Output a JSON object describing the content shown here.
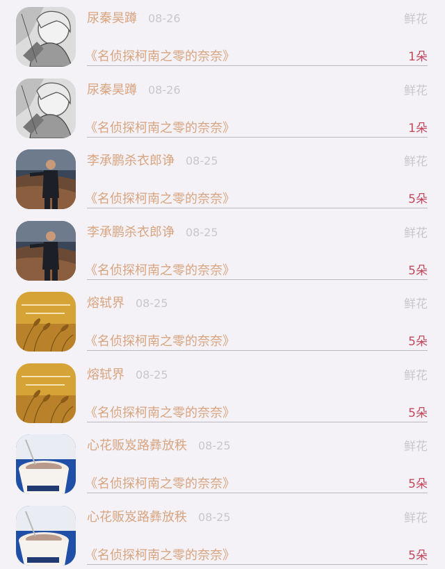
{
  "items": [
    {
      "name": "尿秦昊蹲",
      "date": "08-26",
      "gift_type": "鲜花",
      "book": "《名侦探柯南之零的奈奈》",
      "count": "1朵",
      "avatar_icon": "anime-sketch-avatar-icon"
    },
    {
      "name": "尿秦昊蹲",
      "date": "08-26",
      "gift_type": "鲜花",
      "book": "《名侦探柯南之零的奈奈》",
      "count": "1朵",
      "avatar_icon": "anime-sketch-avatar-icon"
    },
    {
      "name": "李承鹏杀衣郎诤",
      "date": "08-25",
      "gift_type": "鲜花",
      "book": "《名侦探柯南之零的奈奈》",
      "count": "5朵",
      "avatar_icon": "suited-man-avatar-icon"
    },
    {
      "name": "李承鹏杀衣郎诤",
      "date": "08-25",
      "gift_type": "鲜花",
      "book": "《名侦探柯南之零的奈奈》",
      "count": "5朵",
      "avatar_icon": "suited-man-avatar-icon"
    },
    {
      "name": "熔轼界",
      "date": "08-25",
      "gift_type": "鲜花",
      "book": "《名侦探柯南之零的奈奈》",
      "count": "5朵",
      "avatar_icon": "wheat-field-avatar-icon"
    },
    {
      "name": "熔轼界",
      "date": "08-25",
      "gift_type": "鲜花",
      "book": "《名侦探柯南之零的奈奈》",
      "count": "5朵",
      "avatar_icon": "wheat-field-avatar-icon"
    },
    {
      "name": "心花贩岌路彝放秩",
      "date": "08-25",
      "gift_type": "鲜花",
      "book": "《名侦探柯南之零的奈奈》",
      "count": "5朵",
      "avatar_icon": "coffee-cup-avatar-icon"
    },
    {
      "name": "心花贩岌路彝放秩",
      "date": "08-25",
      "gift_type": "鲜花",
      "book": "《名侦探柯南之零的奈奈》",
      "count": "5朵",
      "avatar_icon": "coffee-cup-avatar-icon"
    }
  ],
  "colors": {
    "background": "#f4f2f7",
    "name_text": "#d9a480",
    "muted_text": "#c9c6cc",
    "count_text": "#c4485c",
    "divider": "#b9b7bd"
  }
}
